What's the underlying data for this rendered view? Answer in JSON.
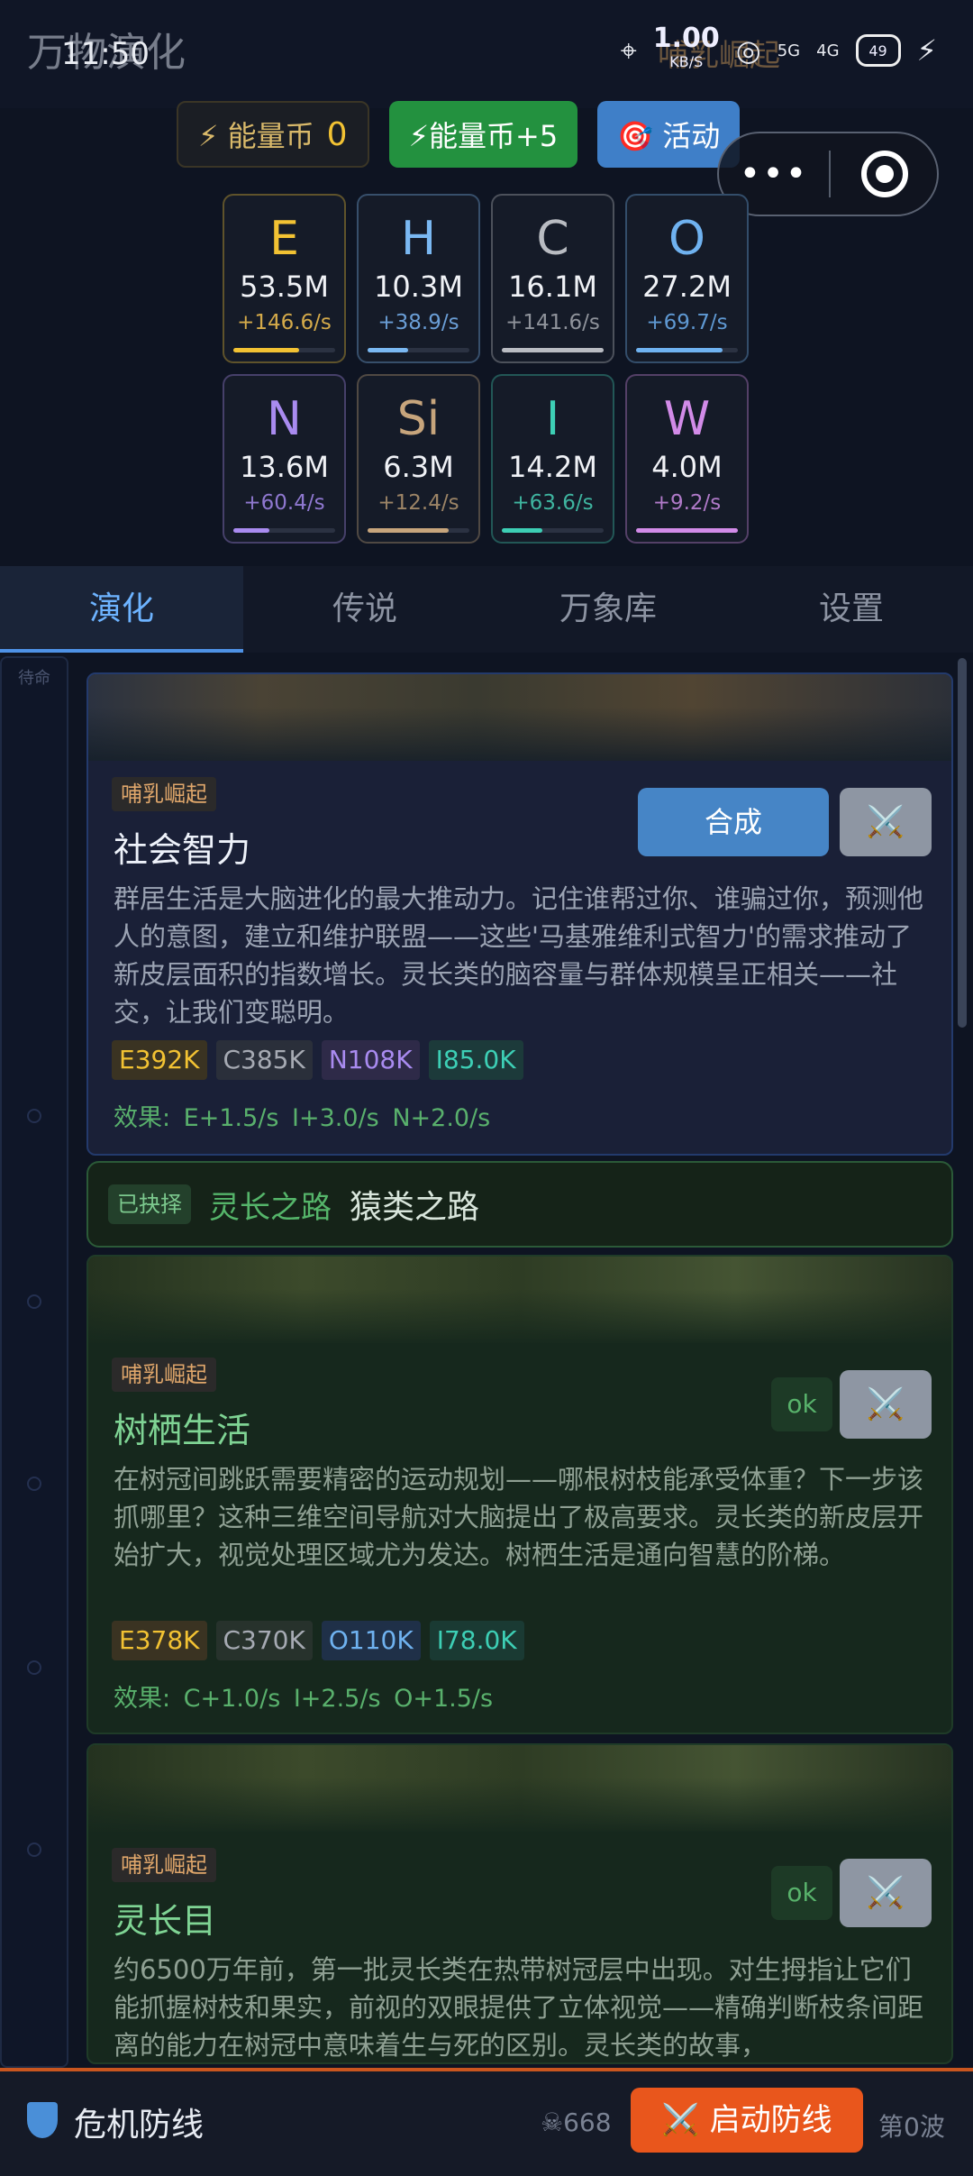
{
  "status": {
    "app_title": "万物演化",
    "time": "11:50",
    "speed_value": "1.00",
    "speed_unit": "KB/S",
    "overlay_text": "哺乳崛起",
    "net1": "5G",
    "net2": "4G",
    "battery": "49"
  },
  "currency": {
    "coin_label": "⚡ 能量币",
    "coin_value": "0",
    "plus_button": "⚡能量币+5",
    "activity_button": "🎯 活动"
  },
  "capsule": {
    "more": "•••"
  },
  "elements": [
    {
      "sym": "E",
      "amount": "53.5M",
      "rate": "+146.6/s",
      "color": "#f2c233",
      "rate_color": "#d4aa4a",
      "fill": 0.65
    },
    {
      "sym": "H",
      "amount": "10.3M",
      "rate": "+38.9/s",
      "color": "#7ab8f2",
      "rate_color": "#6a9ed6",
      "fill": 0.4
    },
    {
      "sym": "C",
      "amount": "16.1M",
      "rate": "+141.6/s",
      "color": "#b9bcc2",
      "rate_color": "#8f939b",
      "fill": 1.0
    },
    {
      "sym": "O",
      "amount": "27.2M",
      "rate": "+69.7/s",
      "color": "#6fb2f0",
      "rate_color": "#5f99d3",
      "fill": 0.85
    },
    {
      "sym": "N",
      "amount": "13.6M",
      "rate": "+60.4/s",
      "color": "#a98bf0",
      "rate_color": "#8f78d0",
      "fill": 0.35
    },
    {
      "sym": "Si",
      "amount": "6.3M",
      "rate": "+12.4/s",
      "color": "#c7a57c",
      "rate_color": "#9c8466",
      "fill": 0.8
    },
    {
      "sym": "I",
      "amount": "14.2M",
      "rate": "+63.6/s",
      "color": "#3dcfb5",
      "rate_color": "#3fb5a0",
      "fill": 0.4
    },
    {
      "sym": "W",
      "amount": "4.0M",
      "rate": "+9.2/s",
      "color": "#d28be8",
      "rate_color": "#b07ac9",
      "fill": 1.0
    }
  ],
  "tabs": [
    "演化",
    "传说",
    "万象库",
    "设置"
  ],
  "rail_label": "待命",
  "cards": [
    {
      "era": "哺乳崛起",
      "title": "社会智力",
      "craft_button": "合成",
      "battle_icon": "⚔️",
      "description": "群居生活是大脑进化的最大推动力。记住谁帮过你、谁骗过你，预测他人的意图，建立和维护联盟——这些'马基雅维利式智力'的需求推动了新皮层面积的指数增长。灵长类的脑容量与群体规模呈正相关——社交，让我们变聪明。",
      "costs": [
        {
          "text": "E392K",
          "fg": "#f2c233",
          "bg": "#3a3322"
        },
        {
          "text": "C385K",
          "fg": "#a6aab3",
          "bg": "#2a2f3a"
        },
        {
          "text": "N108K",
          "fg": "#a98bf0",
          "bg": "#2e2a48"
        },
        {
          "text": "I85.0K",
          "fg": "#3dcfb5",
          "bg": "#1c3a3a"
        }
      ],
      "effect": "效果: E+1.5/s  I+3.0/s  N+2.0/s"
    },
    {
      "era": "哺乳崛起",
      "title": "树栖生活",
      "ok_button": "ok",
      "battle_icon": "⚔️",
      "description": "在树冠间跳跃需要精密的运动规划——哪根树枝能承受体重？下一步该抓哪里？这种三维空间导航对大脑提出了极高要求。灵长类的新皮层开始扩大，视觉处理区域尤为发达。树栖生活是通向智慧的阶梯。",
      "costs": [
        {
          "text": "E378K",
          "fg": "#f2c233",
          "bg": "#3a3322"
        },
        {
          "text": "C370K",
          "fg": "#a6aab3",
          "bg": "#27322c"
        },
        {
          "text": "O110K",
          "fg": "#6fb2f0",
          "bg": "#1f3048"
        },
        {
          "text": "I78.0K",
          "fg": "#3dcfb5",
          "bg": "#1a3a33"
        }
      ],
      "effect": "效果: C+1.0/s  I+2.5/s  O+1.5/s"
    },
    {
      "era": "哺乳崛起",
      "title": "灵长目",
      "ok_button": "ok",
      "battle_icon": "⚔️",
      "description": "约6500万年前，第一批灵长类在热带树冠层中出现。对生拇指让它们能抓握树枝和果实，前视的双眼提供了立体视觉——精确判断枝条间距离的能力在树冠中意味着生与死的区别。灵长类的故事，"
    }
  ],
  "path": {
    "tag": "已抉择",
    "chosen": "灵长之路",
    "other": "猿类之路"
  },
  "bottom": {
    "title": "危机防线",
    "kills": "☠668",
    "start_button": "⚔️ 启动防线",
    "wave": "第0波"
  }
}
